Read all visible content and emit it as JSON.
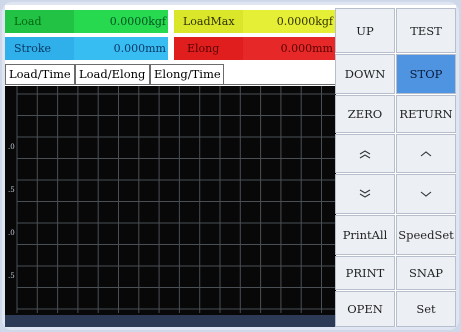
{
  "readouts": {
    "load": {
      "label": "Load",
      "value": "0.0000kgf"
    },
    "load_max": {
      "label": "LoadMax",
      "value": "0.0000kgf"
    },
    "stroke": {
      "label": "Stroke",
      "value": "0.000mm"
    },
    "elong": {
      "label": "Elong",
      "value": "0.000mm"
    }
  },
  "tabs": [
    "Load/Time",
    "Load/Elong",
    "Elong/Time"
  ],
  "buttons": {
    "up": "UP",
    "test": "TEST",
    "down": "DOWN",
    "stop": "STOP",
    "zero": "ZERO",
    "return": "RETURN",
    "print_all": "PrintAll",
    "speed_set": "SpeedSet",
    "print": "PRINT",
    "snap": "SNAP",
    "open": "OPEN",
    "set": "Set"
  },
  "icons": {
    "fast_up": "double-chevron-up-icon",
    "slow_up": "chevron-up-icon",
    "fast_down": "double-chevron-down-icon",
    "slow_down": "chevron-down-icon"
  },
  "plot": {
    "y_ticks": [
      ".0",
      ".5",
      ".0",
      ".5"
    ],
    "grid": true
  },
  "colors": {
    "load_label_bg": "#22c244",
    "load_value_bg": "#26d94f",
    "loadmax_label_bg": "#d9e62a",
    "loadmax_value_bg": "#e4ef36",
    "stroke_label_bg": "#2fb0ea",
    "stroke_value_bg": "#38bdf3",
    "elong_label_bg": "#e01e1e",
    "elong_value_bg": "#e62828",
    "active_button": "#4f94e0",
    "plot_bg": "#080808",
    "grid": "#4a4f56"
  }
}
